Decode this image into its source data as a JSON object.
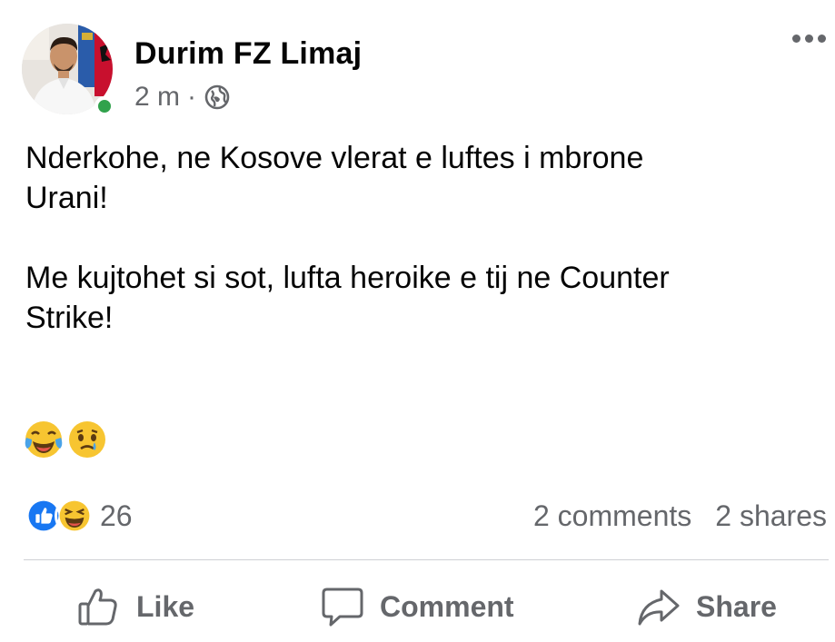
{
  "post": {
    "author": "Durim FZ Limaj",
    "time": "2 m",
    "separator": "·",
    "privacy_icon": "globe-icon",
    "more_icon": "more-options-icon",
    "paragraphs": [
      "Nderkohe, ne Kosove vlerat e luftes i mbrone",
      "Urani!",
      "Me kujtohet si sot, lufta heroike e  tij ne Counter",
      "Strike!"
    ],
    "emojis": [
      "face-with-tears-of-joy",
      "crying-face"
    ]
  },
  "reactions": {
    "icons": [
      "like-reaction-icon",
      "haha-reaction-icon"
    ],
    "count": "26",
    "comments": "2 comments",
    "shares": "2 shares"
  },
  "actions": {
    "like_label": "Like",
    "comment_label": "Comment",
    "share_label": "Share"
  },
  "colors": {
    "text": "#050505",
    "secondary": "#65676b",
    "like_blue": "#1877f2",
    "online_green": "#31a24c",
    "divider": "#ced0d4"
  }
}
